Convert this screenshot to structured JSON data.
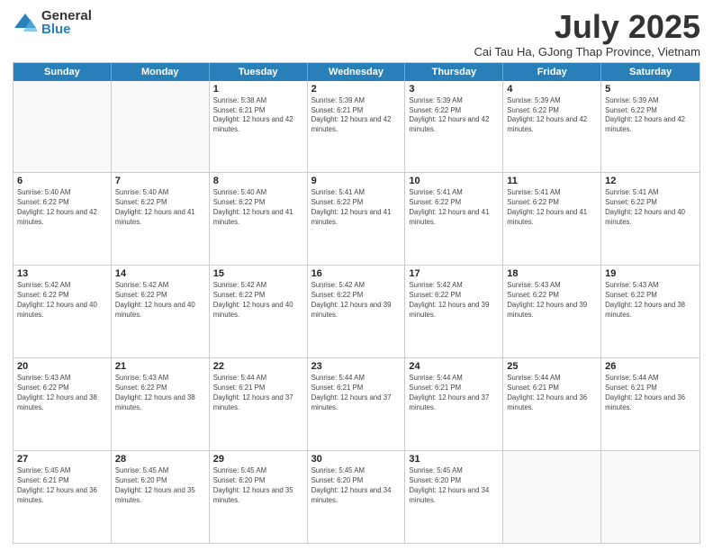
{
  "logo": {
    "general": "General",
    "blue": "Blue"
  },
  "title": "July 2025",
  "location": "Cai Tau Ha, GJong Thap Province, Vietnam",
  "header_days": [
    "Sunday",
    "Monday",
    "Tuesday",
    "Wednesday",
    "Thursday",
    "Friday",
    "Saturday"
  ],
  "weeks": [
    [
      {
        "day": "",
        "info": ""
      },
      {
        "day": "",
        "info": ""
      },
      {
        "day": "1",
        "info": "Sunrise: 5:38 AM\nSunset: 6:21 PM\nDaylight: 12 hours and 42 minutes."
      },
      {
        "day": "2",
        "info": "Sunrise: 5:39 AM\nSunset: 6:21 PM\nDaylight: 12 hours and 42 minutes."
      },
      {
        "day": "3",
        "info": "Sunrise: 5:39 AM\nSunset: 6:22 PM\nDaylight: 12 hours and 42 minutes."
      },
      {
        "day": "4",
        "info": "Sunrise: 5:39 AM\nSunset: 6:22 PM\nDaylight: 12 hours and 42 minutes."
      },
      {
        "day": "5",
        "info": "Sunrise: 5:39 AM\nSunset: 6:22 PM\nDaylight: 12 hours and 42 minutes."
      }
    ],
    [
      {
        "day": "6",
        "info": "Sunrise: 5:40 AM\nSunset: 6:22 PM\nDaylight: 12 hours and 42 minutes."
      },
      {
        "day": "7",
        "info": "Sunrise: 5:40 AM\nSunset: 6:22 PM\nDaylight: 12 hours and 41 minutes."
      },
      {
        "day": "8",
        "info": "Sunrise: 5:40 AM\nSunset: 6:22 PM\nDaylight: 12 hours and 41 minutes."
      },
      {
        "day": "9",
        "info": "Sunrise: 5:41 AM\nSunset: 6:22 PM\nDaylight: 12 hours and 41 minutes."
      },
      {
        "day": "10",
        "info": "Sunrise: 5:41 AM\nSunset: 6:22 PM\nDaylight: 12 hours and 41 minutes."
      },
      {
        "day": "11",
        "info": "Sunrise: 5:41 AM\nSunset: 6:22 PM\nDaylight: 12 hours and 41 minutes."
      },
      {
        "day": "12",
        "info": "Sunrise: 5:41 AM\nSunset: 6:22 PM\nDaylight: 12 hours and 40 minutes."
      }
    ],
    [
      {
        "day": "13",
        "info": "Sunrise: 5:42 AM\nSunset: 6:22 PM\nDaylight: 12 hours and 40 minutes."
      },
      {
        "day": "14",
        "info": "Sunrise: 5:42 AM\nSunset: 6:22 PM\nDaylight: 12 hours and 40 minutes."
      },
      {
        "day": "15",
        "info": "Sunrise: 5:42 AM\nSunset: 6:22 PM\nDaylight: 12 hours and 40 minutes."
      },
      {
        "day": "16",
        "info": "Sunrise: 5:42 AM\nSunset: 6:22 PM\nDaylight: 12 hours and 39 minutes."
      },
      {
        "day": "17",
        "info": "Sunrise: 5:42 AM\nSunset: 6:22 PM\nDaylight: 12 hours and 39 minutes."
      },
      {
        "day": "18",
        "info": "Sunrise: 5:43 AM\nSunset: 6:22 PM\nDaylight: 12 hours and 39 minutes."
      },
      {
        "day": "19",
        "info": "Sunrise: 5:43 AM\nSunset: 6:22 PM\nDaylight: 12 hours and 38 minutes."
      }
    ],
    [
      {
        "day": "20",
        "info": "Sunrise: 5:43 AM\nSunset: 6:22 PM\nDaylight: 12 hours and 38 minutes."
      },
      {
        "day": "21",
        "info": "Sunrise: 5:43 AM\nSunset: 6:22 PM\nDaylight: 12 hours and 38 minutes."
      },
      {
        "day": "22",
        "info": "Sunrise: 5:44 AM\nSunset: 6:21 PM\nDaylight: 12 hours and 37 minutes."
      },
      {
        "day": "23",
        "info": "Sunrise: 5:44 AM\nSunset: 6:21 PM\nDaylight: 12 hours and 37 minutes."
      },
      {
        "day": "24",
        "info": "Sunrise: 5:44 AM\nSunset: 6:21 PM\nDaylight: 12 hours and 37 minutes."
      },
      {
        "day": "25",
        "info": "Sunrise: 5:44 AM\nSunset: 6:21 PM\nDaylight: 12 hours and 36 minutes."
      },
      {
        "day": "26",
        "info": "Sunrise: 5:44 AM\nSunset: 6:21 PM\nDaylight: 12 hours and 36 minutes."
      }
    ],
    [
      {
        "day": "27",
        "info": "Sunrise: 5:45 AM\nSunset: 6:21 PM\nDaylight: 12 hours and 36 minutes."
      },
      {
        "day": "28",
        "info": "Sunrise: 5:45 AM\nSunset: 6:20 PM\nDaylight: 12 hours and 35 minutes."
      },
      {
        "day": "29",
        "info": "Sunrise: 5:45 AM\nSunset: 6:20 PM\nDaylight: 12 hours and 35 minutes."
      },
      {
        "day": "30",
        "info": "Sunrise: 5:45 AM\nSunset: 6:20 PM\nDaylight: 12 hours and 34 minutes."
      },
      {
        "day": "31",
        "info": "Sunrise: 5:45 AM\nSunset: 6:20 PM\nDaylight: 12 hours and 34 minutes."
      },
      {
        "day": "",
        "info": ""
      },
      {
        "day": "",
        "info": ""
      }
    ]
  ]
}
